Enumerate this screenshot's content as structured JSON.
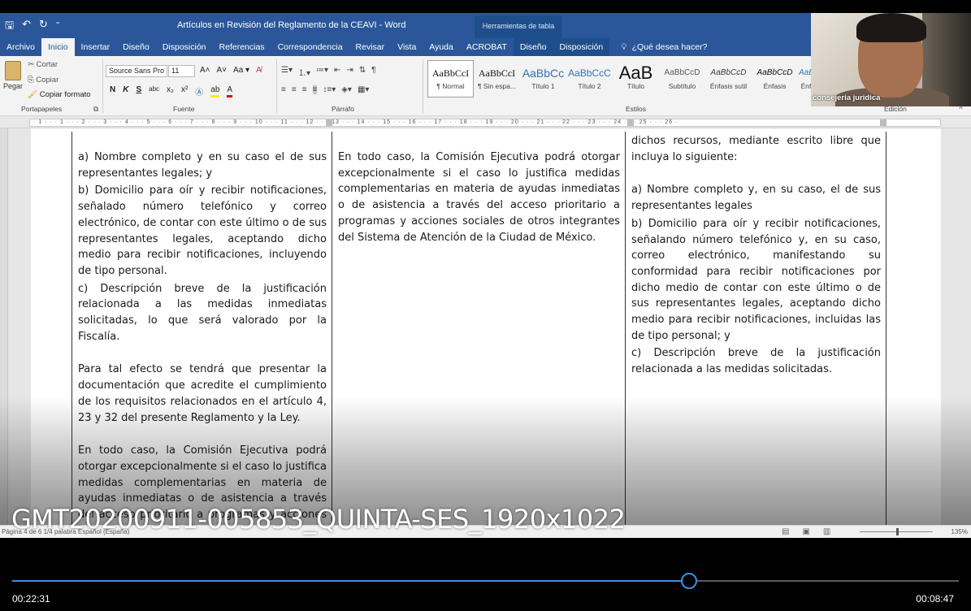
{
  "window": {
    "title": "Artículos en Revisión del Reglamento de la CEAVI  -  Word",
    "context_tab_group": "Herramientas de tabla"
  },
  "ribbon_tabs": [
    "Archivo",
    "Inicio",
    "Insertar",
    "Diseño",
    "Disposición",
    "Referencias",
    "Correspondencia",
    "Revisar",
    "Vista",
    "Ayuda",
    "ACROBAT",
    "Diseño",
    "Disposición"
  ],
  "tell_me": "¿Qué desea hacer?",
  "clipboard": {
    "paste": "Pegar",
    "cut": "Cortar",
    "copy": "Copiar",
    "format_painter": "Copiar formato",
    "group_label": "Portapapeles"
  },
  "font": {
    "name": "Source Sans Pro",
    "size": "11",
    "group_label": "Fuente",
    "bold": "N",
    "italic": "K",
    "underline": "S"
  },
  "paragraph": {
    "group_label": "Párrafo"
  },
  "styles": {
    "group_label": "Estilos",
    "items": [
      {
        "preview": "AaBbCcI",
        "name": "¶ Normal"
      },
      {
        "preview": "AaBbCcI",
        "name": "¶ Sin espa..."
      },
      {
        "preview": "AaBbCc",
        "name": "Título 1"
      },
      {
        "preview": "AaBbCcC",
        "name": "Título 2"
      },
      {
        "preview": "AaB",
        "name": "Título"
      },
      {
        "preview": "AaBbCcD",
        "name": "Subtítulo"
      },
      {
        "preview": "AaBbCcD",
        "name": "Énfasis sutil"
      },
      {
        "preview": "AaBbCcD",
        "name": "Énfasis"
      },
      {
        "preview": "AaBbCcD",
        "name": "Énf"
      }
    ]
  },
  "editing": {
    "group_label": "Edición"
  },
  "ruler_text": "· 1 · · · 1 · · · 2 · · · 3 · · · 4 · · · 5 · · · 6 · · · 7 · · · 8 · · · 9 · · · 10 · · · 11 · · · 12 · · · 13 · · · 14 · · · 15 · · · 16 · · · 17 · · · 18 · · · 19 · · · 20 · · · 21 · · · 22 · · · 23 · · · 24 · · · 25 · · · 26 ·",
  "document": {
    "col1": [
      "a) Nombre completo y en su caso el de sus representantes legales; y",
      "b) Domicilio para oír y recibir notificaciones, señalado número telefónico y correo electrónico, de contar con este último o de sus representantes legales, aceptando dicho medio para recibir notificaciones, incluyendo de tipo personal.",
      "c) Descripción breve de la justificación relacionada a las medidas inmediatas solicitadas, lo que será valorado por la Fiscalía.",
      "Para tal efecto se tendrá que presentar la documentación que acredite el cumplimiento de los requisitos relacionados en el artículo 4, 23 y 32 del presente Reglamento y la Ley.",
      "En todo caso, la Comisión Ejecutiva podrá otorgar excepcionalmente si el caso lo justifica medidas complementarias en materia de ayudas inmediatas o de asistencia a través del acceso prioritario a programas y acciones sociales de otros integrantes del Sistema de"
    ],
    "col2": [
      "En todo caso, la Comisión Ejecutiva podrá otorgar excepcionalmente si el caso lo justifica medidas complementarias en materia de ayudas inmediatas o de asistencia a través del acceso prioritario a programas y acciones sociales de otros integrantes del Sistema de Atención de la Ciudad de México."
    ],
    "col3": [
      "dichos recursos, mediante escrito libre que incluya lo siguiente:",
      "a) Nombre completo y, en su caso, el de sus representantes legales",
      "b) Domicilio para oír y recibir notificaciones, señalando número telefónico y, en su caso, correo electrónico, manifestando su conformidad para recibir notificaciones por dicho medio de contar con este último o de sus representantes legales, aceptando dicho medio para recibir notificaciones, incluidas las de tipo personal; y",
      "c) Descripción breve de la justificación relacionada a las medidas solicitadas."
    ]
  },
  "statusbar": {
    "left": "Página 4 de 6   1/4 palabra   Español (España)",
    "zoom": "135%"
  },
  "webcam": {
    "label": "consejeria juridica"
  },
  "video": {
    "filename": "GMT20200911-005853_QUINTA-SES_1920x1022",
    "elapsed": "00:22:31",
    "remaining": "00:08:47",
    "progress": 0.715,
    "accent": "#3a8ee6"
  }
}
